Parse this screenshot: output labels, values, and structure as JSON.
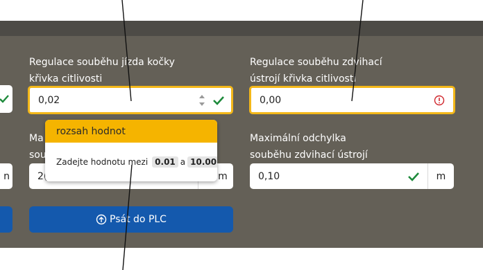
{
  "left_partial": {
    "unit": "n"
  },
  "col1": {
    "label_line1": "Regulace souběhu jízda kočky",
    "label_line2": "křivka citlivosti",
    "value": "0,02",
    "label2_line1_partial": "Ma",
    "label2_line2_partial": "sou",
    "value2_partial": "2(",
    "unit": "m",
    "button_label": "Psát do PLC"
  },
  "col2": {
    "label_line1": "Regulace souběhu zdvihací",
    "label_line2": "ústrojí křivka citlivosti",
    "value": "0,00",
    "label2_line1": "Maximální odchylka",
    "label2_line2": "souběhu zdvihací ústrojí",
    "value2": "0,10",
    "unit": "m"
  },
  "tooltip": {
    "title": "rozsah hodnot",
    "text_before": "Zadejte hodnotu mezi",
    "min": "0.01",
    "joiner": "a",
    "max": "10.00"
  },
  "colors": {
    "panel": "#646057",
    "panel_top": "#4d4b46",
    "warning_border": "#f3b719",
    "valid_check": "#1d8a3b",
    "error_icon": "#d0262c",
    "button": "#1459ad",
    "tooltip_header": "#f5b400"
  }
}
